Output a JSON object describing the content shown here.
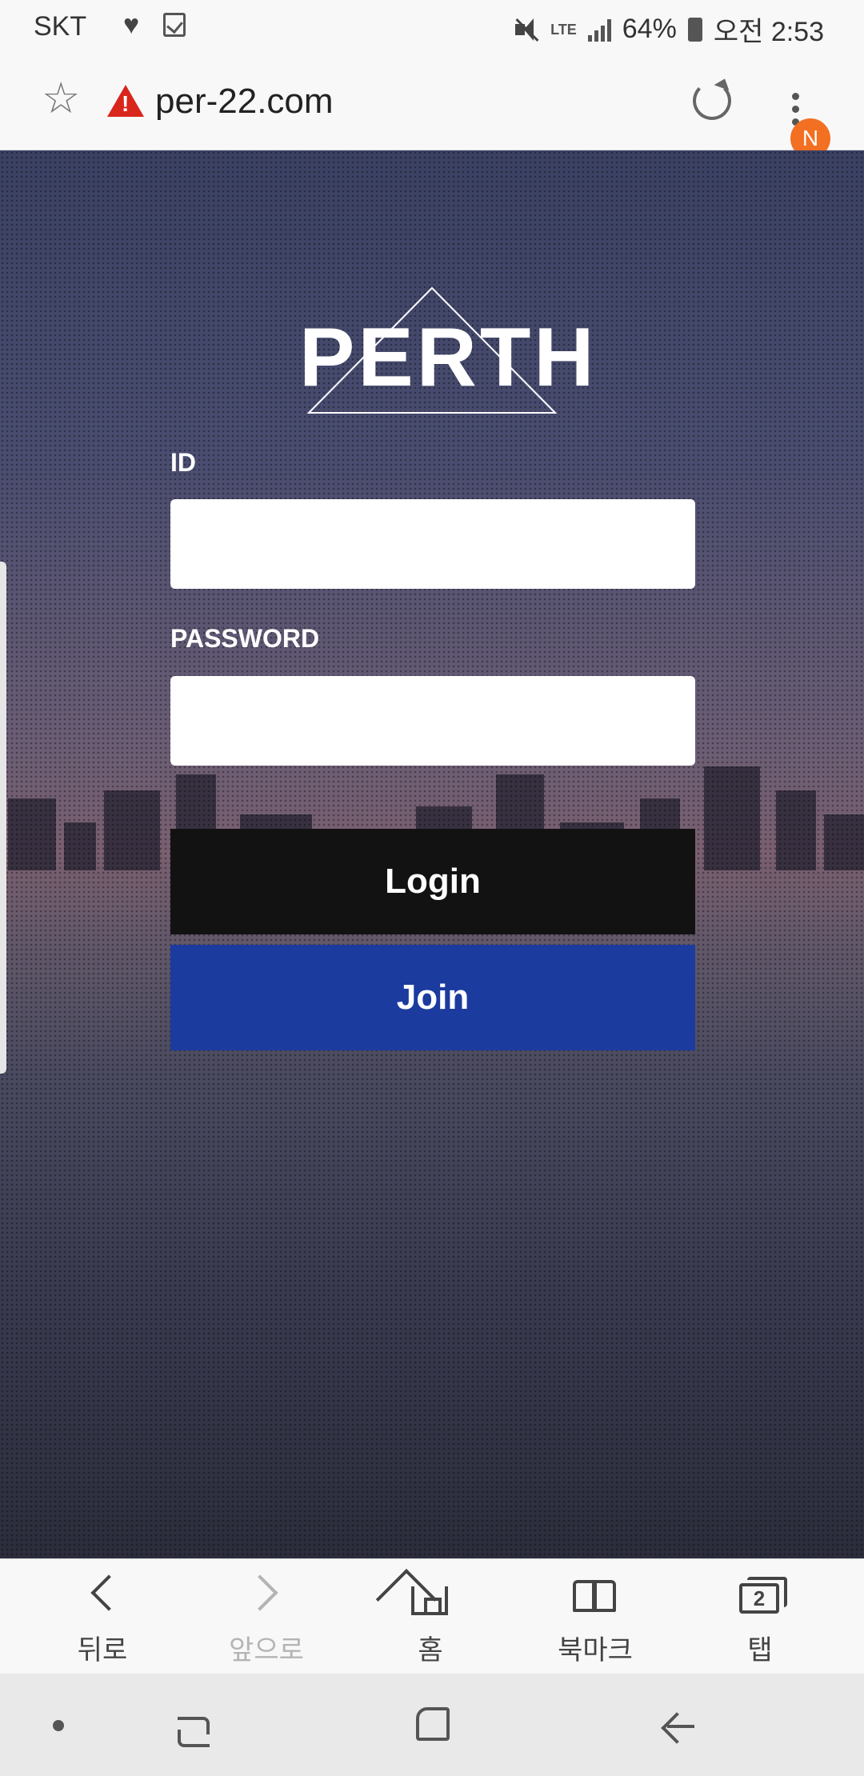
{
  "status_bar": {
    "carrier": "SKT",
    "network": "LTE",
    "battery": "64%",
    "time": "오전 2:53",
    "icons": [
      "heart-icon",
      "task-icon",
      "mute-icon",
      "signal-icon",
      "battery-icon"
    ]
  },
  "browser": {
    "url": "per-22.com",
    "security": "warning",
    "notification_badge": "N",
    "accent_color": "#f36f21"
  },
  "page": {
    "logo_text": "PERTH",
    "id_label": "ID",
    "id_value": "",
    "password_label": "PASSWORD",
    "password_value": "",
    "login_button": "Login",
    "join_button": "Join",
    "colors": {
      "login_button": "#121212",
      "join_button": "#1c3b9f"
    }
  },
  "browser_nav": {
    "back": "뒤로",
    "forward": "앞으로",
    "home": "홈",
    "bookmarks": "북마크",
    "tabs": "탭",
    "tab_count": "2"
  }
}
